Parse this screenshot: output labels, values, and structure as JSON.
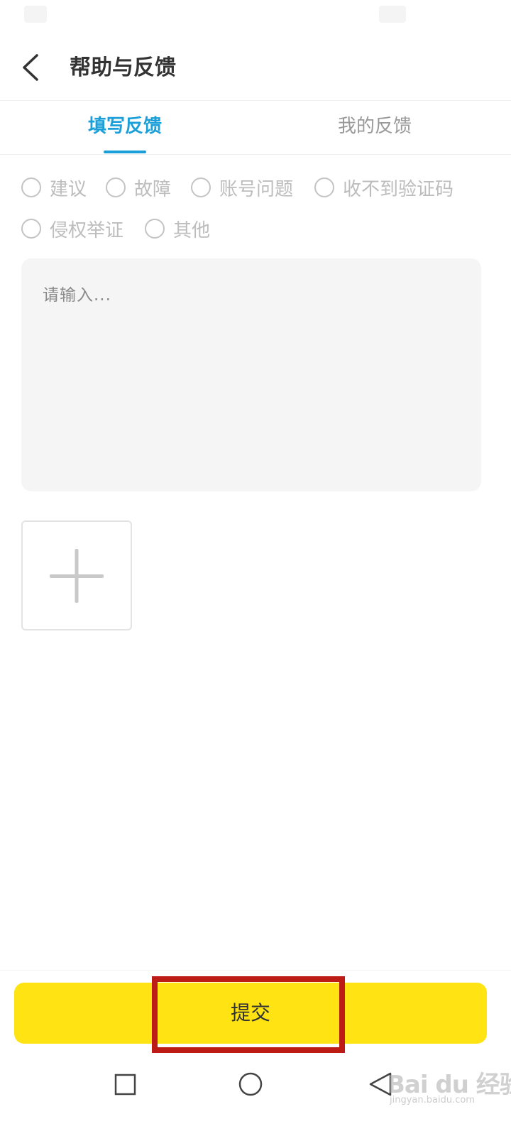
{
  "header": {
    "title": "帮助与反馈"
  },
  "tabs": [
    {
      "label": "填写反馈",
      "active": true
    },
    {
      "label": "我的反馈",
      "active": false
    }
  ],
  "categories": {
    "row1": [
      "建议",
      "故障",
      "账号问题",
      "收不到验证码"
    ],
    "row2": [
      "侵权举证",
      "其他"
    ]
  },
  "feedback": {
    "placeholder": "请输入..."
  },
  "upload": {
    "icon": "plus-icon"
  },
  "submit": {
    "label": "提交"
  },
  "nav": {
    "icons": [
      "recent-apps-icon",
      "home-icon",
      "back-nav-icon"
    ]
  },
  "watermark": {
    "text": "Bai du 经验",
    "url": "jingyan.baidu.com"
  },
  "colors": {
    "accent": "#1a9fd8",
    "submit_bg": "#ffe312",
    "highlight": "#bd1c16"
  }
}
